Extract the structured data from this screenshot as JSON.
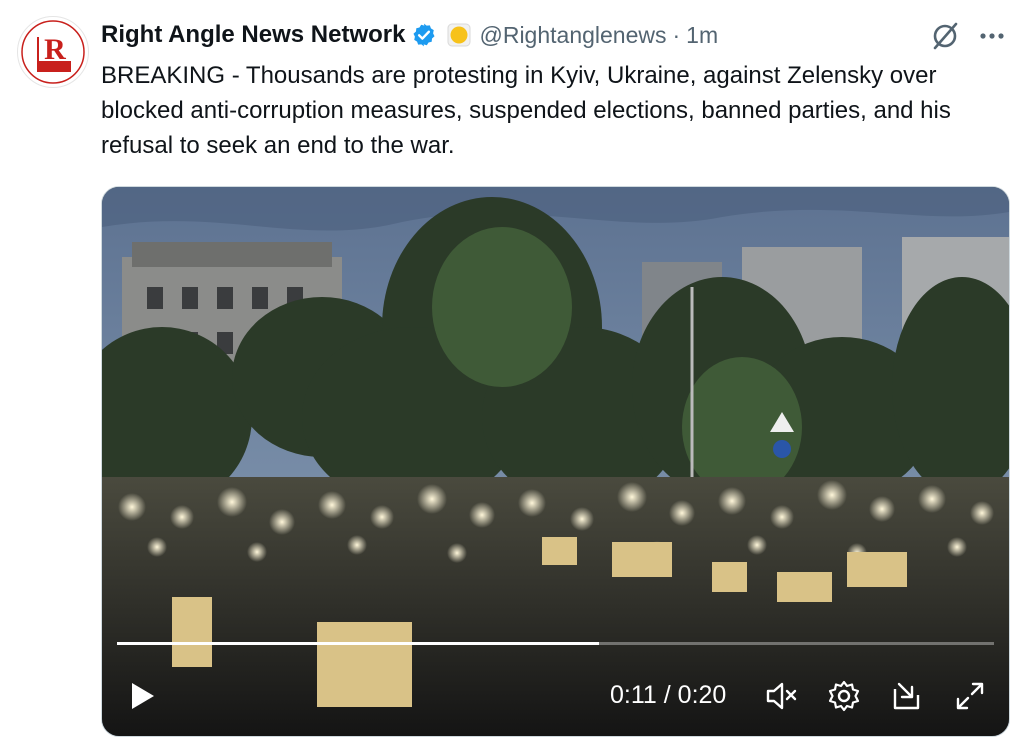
{
  "tweet": {
    "author_name": "Right Angle News Network",
    "handle": "@Rightanglenews",
    "separator": "·",
    "time": "1m",
    "text": "BREAKING - Thousands are protesting in Kyiv, Ukraine, against Zelensky over blocked anti-corruption measures, suspended elections, banned parties, and his refusal to seek an end to the war.",
    "avatar": {
      "logo_letter": "R",
      "logo_top_text": "RIGHT ANGLE",
      "logo_bottom_text": "NEWS",
      "accent": "#c8201c"
    },
    "icons": [
      "verified-badge-icon",
      "yellow-circle-emoji-icon",
      "grok-icon",
      "more-icon"
    ],
    "verified_color": "#1d9bf0"
  },
  "video": {
    "current_time": "0:11",
    "duration": "0:20",
    "time_separator": "/",
    "progress": 0.55,
    "controls": [
      "play-icon",
      "mute-icon",
      "settings-icon",
      "pop-out-icon",
      "fullscreen-icon"
    ]
  }
}
